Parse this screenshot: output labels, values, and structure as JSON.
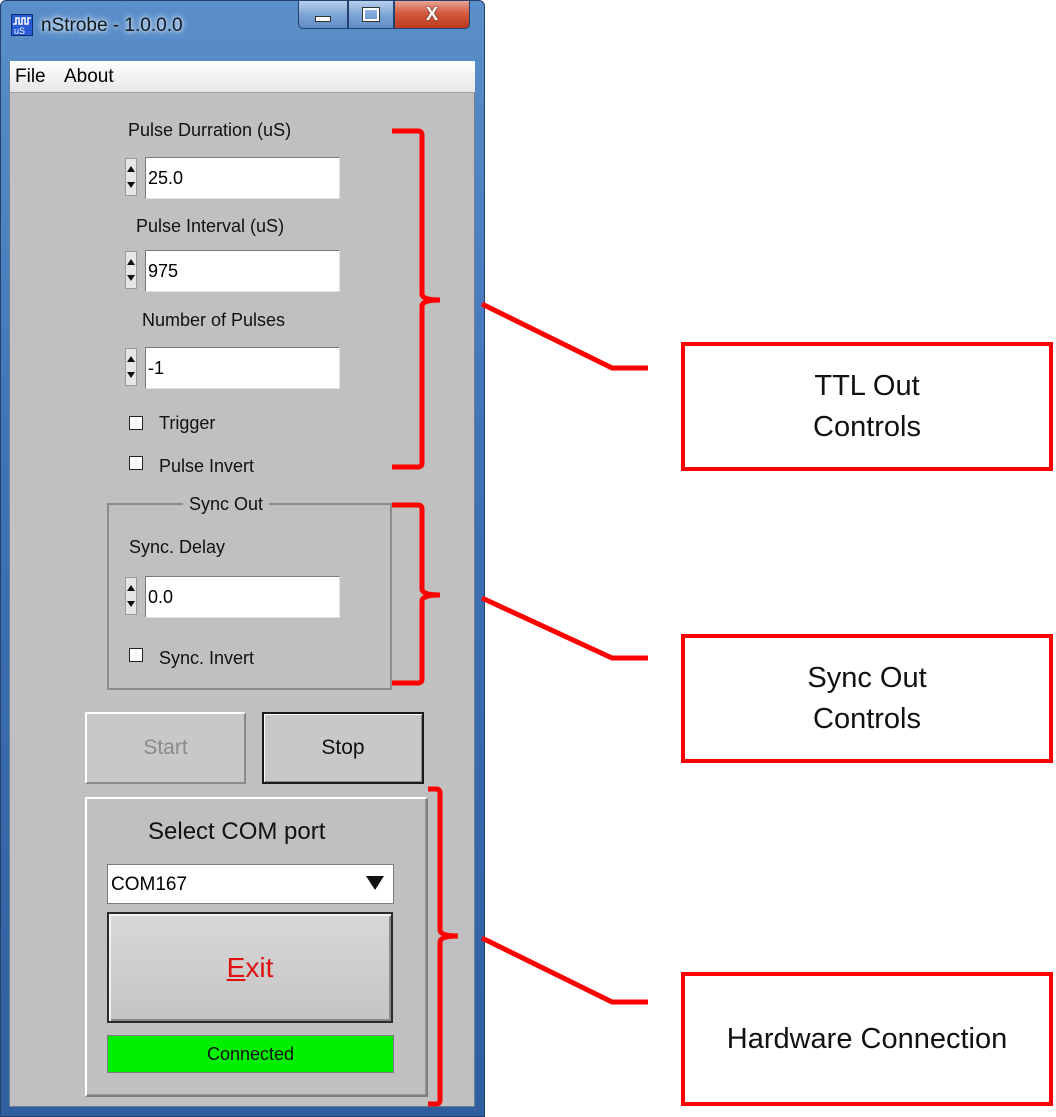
{
  "window": {
    "title": "nStrobe - 1.0.0.0",
    "controls": {
      "minimize": "minimize-icon",
      "maximize": "maximize-icon",
      "close_label": "X"
    }
  },
  "menu": {
    "items": [
      "File",
      "About"
    ]
  },
  "ttl": {
    "pulse_duration_label": "Pulse Durration (uS)",
    "pulse_duration_value": "25.0",
    "pulse_interval_label": "Pulse Interval (uS)",
    "pulse_interval_value": "975",
    "num_pulses_label": "Number of Pulses",
    "num_pulses_value": "-1",
    "trigger_label": "Trigger",
    "trigger_checked": false,
    "pulse_invert_label": "Pulse Invert",
    "pulse_invert_checked": false
  },
  "sync": {
    "group_title": "Sync Out",
    "delay_label": "Sync. Delay",
    "delay_value": "0.0",
    "invert_label": "Sync. Invert",
    "invert_checked": false
  },
  "buttons": {
    "start_label": "Start",
    "start_enabled": false,
    "stop_label": "Stop"
  },
  "com": {
    "title": "Select COM port",
    "selected_port": "COM167",
    "exit_label": "Exit",
    "exit_accelerator": "E",
    "status": "Connected",
    "status_color": "#00f000"
  },
  "annotations": {
    "color": "#ff0000",
    "ttl_callout": "TTL Out\nControls",
    "sync_callout": "Sync Out\nControls",
    "hardware_callout": "Hardware Connection"
  }
}
